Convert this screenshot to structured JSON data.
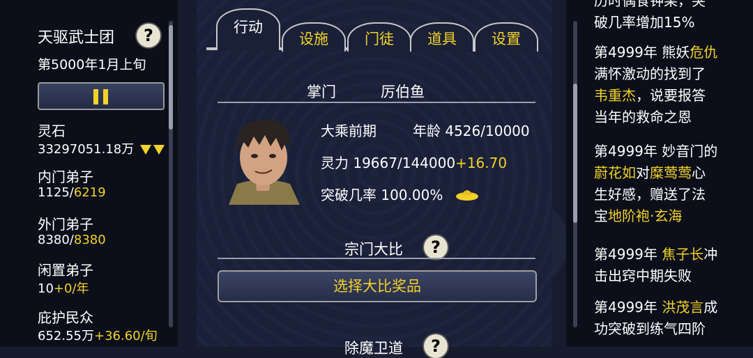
{
  "left": {
    "sect_name": "天驱武士团",
    "date": "第5000年1月上旬",
    "stats": [
      {
        "label": "灵石",
        "value": "33297051.18万",
        "extra": ""
      },
      {
        "label": "内门弟子",
        "value": "1125/",
        "extra": "6219"
      },
      {
        "label": "外门弟子",
        "value": "8380/",
        "extra": "8380"
      },
      {
        "label": "闲置弟子",
        "value": "10",
        "extra": "+0/年"
      },
      {
        "label": "庇护民众",
        "value": "652.55万",
        "extra": "+36.60/旬"
      }
    ]
  },
  "tabs": [
    {
      "label": "行动",
      "active": true
    },
    {
      "label": "设施",
      "active": false
    },
    {
      "label": "门徒",
      "active": false
    },
    {
      "label": "道具",
      "active": false
    },
    {
      "label": "设置",
      "active": false
    }
  ],
  "leader": {
    "title": "掌门",
    "name": "厉伯鱼",
    "realm": "大乘前期",
    "age_label": "年龄",
    "age": "4526/10000",
    "spirit_label": "灵力",
    "spirit": "19667/144000",
    "spirit_rate": "+16.70",
    "breakthrough_label": "突破几率",
    "breakthrough": "100.00%"
  },
  "tournament": {
    "title": "宗门大比",
    "select_label": "选择大比奖品",
    "next_title": "除魔卫道"
  },
  "log": {
    "line0": "历时偶食钟果，突",
    "line1": "破几率增加15%",
    "e1_a": "第4999年 熊妖",
    "e1_b": "危仇",
    "e1_c": "满怀激动的找到了",
    "e1_d": "韦重杰",
    "e1_e": "，说要报答",
    "e1_f": "当年的救命之恩",
    "e2_a": "第4999年 妙音门的",
    "e2_b": "蔚花如",
    "e2_c": "对",
    "e2_d": "糜莺莺",
    "e2_e": "心",
    "e2_f": "生好感，赠送了法",
    "e2_g": "宝",
    "e2_h": "地阶袍·玄海",
    "e3_a": "第4999年 ",
    "e3_b": "焦子长",
    "e3_c": "冲",
    "e3_d": "击出窍中期失败",
    "e4_a": "第4999年 ",
    "e4_b": "洪茂言",
    "e4_c": "成",
    "e4_d": "功突破到练气四阶"
  },
  "colors": {
    "accent": "#f2d22a",
    "panel": "#1a2038"
  }
}
